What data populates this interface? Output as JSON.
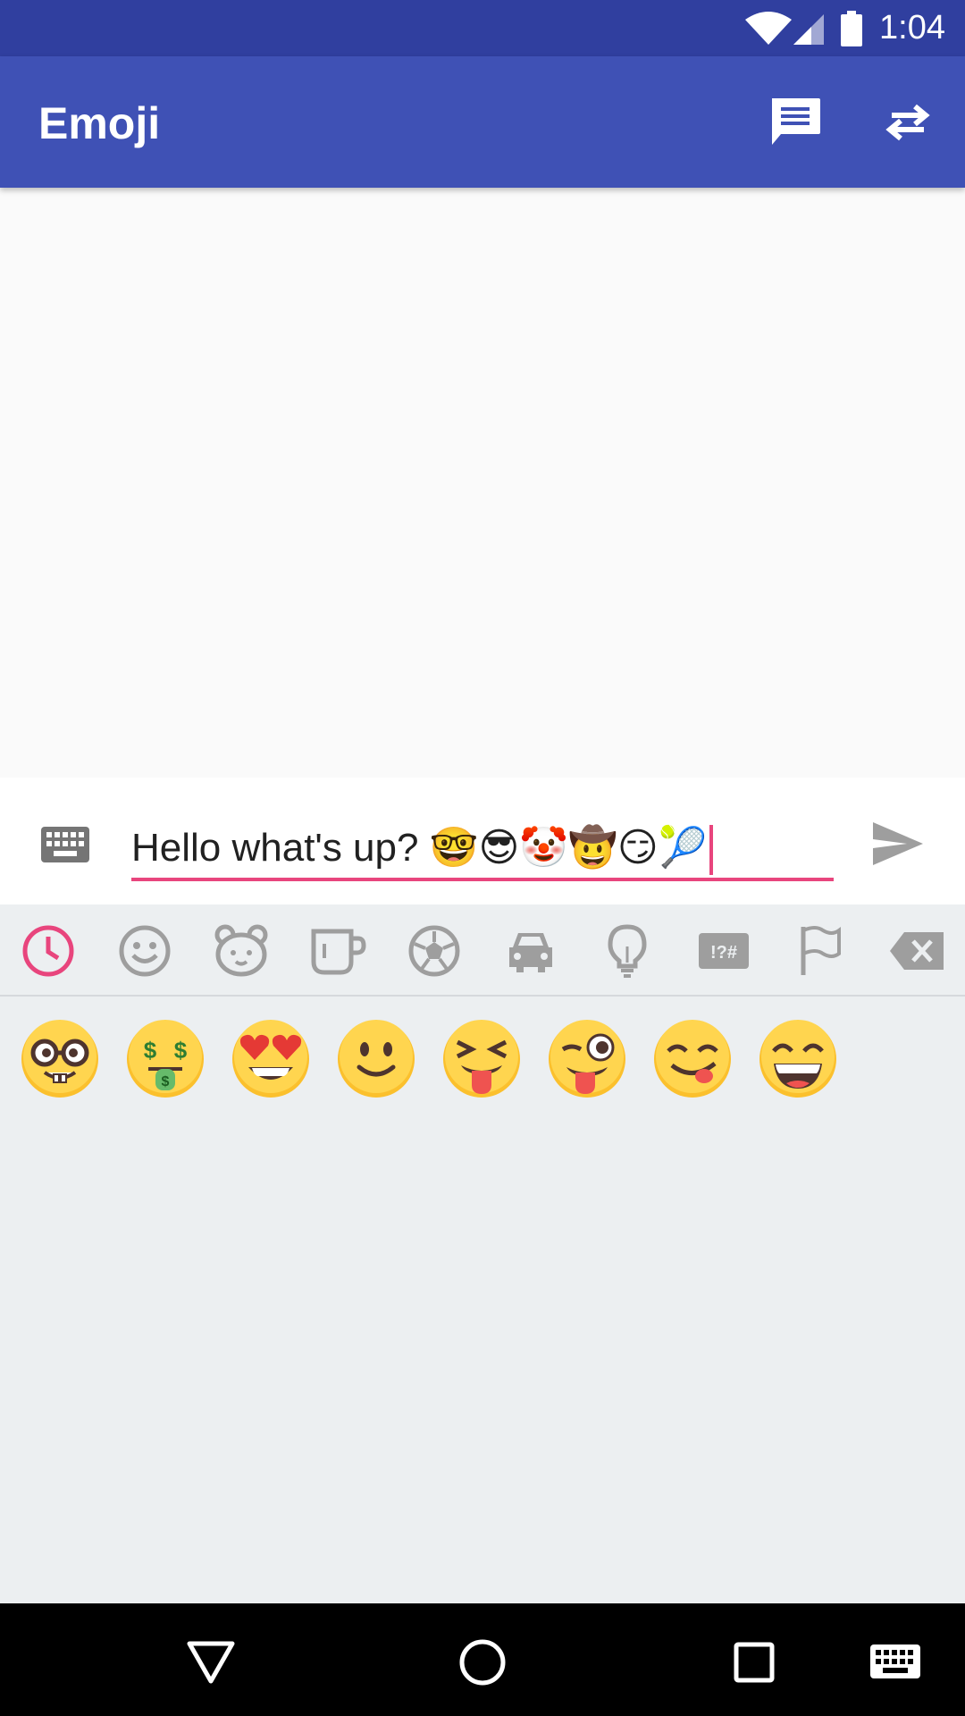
{
  "status_bar": {
    "time": "1:04",
    "wifi_icon": "wifi-icon",
    "signal_icon": "cell-signal-icon",
    "battery_icon": "battery-icon"
  },
  "app_bar": {
    "title": "Emoji",
    "actions": [
      "chat-icon",
      "swap-icon"
    ]
  },
  "input": {
    "text": "Hello what's up? 🤓😎🤡🤠😏🎾",
    "accent_color": "#e8457d",
    "keyboard_toggle_icon": "keyboard-icon",
    "send_icon": "send-icon"
  },
  "emoji_tabs": [
    {
      "name": "recent-clock-icon",
      "selected": true
    },
    {
      "name": "smiley-icon",
      "selected": false
    },
    {
      "name": "animal-bear-icon",
      "selected": false
    },
    {
      "name": "food-cup-icon",
      "selected": false
    },
    {
      "name": "soccer-ball-icon",
      "selected": false
    },
    {
      "name": "car-icon",
      "selected": false
    },
    {
      "name": "lightbulb-icon",
      "selected": false
    },
    {
      "name": "symbols-icon",
      "selected": false,
      "label": "!?#"
    },
    {
      "name": "flag-icon",
      "selected": false
    },
    {
      "name": "backspace-icon",
      "selected": false
    }
  ],
  "recent_emoji": [
    "nerd-face",
    "money-mouth-face",
    "heart-eyes-face",
    "slightly-smiling-face",
    "squinting-tongue-face",
    "winking-tongue-face",
    "yum-face",
    "grinning-smiling-eyes-face"
  ],
  "colors": {
    "primary": "#3f51b5",
    "primary_dark": "#303f9f",
    "accent": "#e8457d",
    "panel": "#eceff1"
  },
  "nav_bar": [
    "back-icon",
    "home-icon",
    "recents-icon",
    "keyboard-icon"
  ]
}
